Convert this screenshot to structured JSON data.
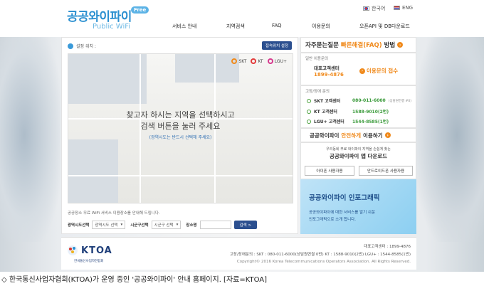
{
  "header": {
    "logo_title": "공공와이파이",
    "logo_badge": "Free",
    "logo_subtitle": "Public WiFi",
    "lang_ko": "한국어",
    "lang_en": "ENG",
    "nav": [
      "서비스 안내",
      "지역검색",
      "FAQ",
      "이용문의",
      "오픈API 및 DB다운로드"
    ]
  },
  "main": {
    "location_label": "설정 위치 :",
    "location_button": "접속위치 설정",
    "carriers": [
      {
        "name": "SKT",
        "color": "#f08a1c"
      },
      {
        "name": "KT",
        "color": "#e23b3b"
      },
      {
        "name": "LGU+",
        "color": "#d63a8e"
      }
    ],
    "map_message_line1": "찾고자 하시는 지역을 선택하시고",
    "map_message_line2": "검색 버튼을 눌러 주세요",
    "map_message_note": "(광역시도는 반드시 선택해 주세요)",
    "info_text": "공공장소 무료 WiFi 서비스 이용장소를 안내해 드립니다.",
    "search": {
      "sido_label": "광역시도선택",
      "sido_value": "광역시도 선택",
      "gugun_label": "시군구선택",
      "gugun_value": "시군구 선택",
      "place_label": "장소명",
      "place_value": "",
      "button": "검색 >"
    }
  },
  "side": {
    "faq_title_a": "자주묻는질문",
    "faq_title_b": "빠른해결(FAQ)",
    "faq_title_c": "방법",
    "general_label": "일반 이용문의",
    "center_name": "대표고객센터",
    "center_number": "1899-4876",
    "inquiry_link": "이용문의 접수",
    "fault_label": "고장/장애 문의",
    "telcos": [
      {
        "name": "SKT 고객센터",
        "number": "080-011-6000",
        "note": "(상담원연결 #0)"
      },
      {
        "name": "KT 고객센터",
        "number": "1588-9010(2번)",
        "note": ""
      },
      {
        "name": "LGU+ 고객센터",
        "number": "1544-8585(1번)",
        "note": ""
      }
    ],
    "safe_a": "공공와이파이",
    "safe_b": "안전하게",
    "safe_c": "이용하기",
    "app_desc": "우리동네 무료 와이파이 지역을 손쉽게 찾는",
    "app_title": "공공와이파이 앱 다운로드",
    "iphone_button": "아이폰 사용자용",
    "android_button": "안드로이드폰 사용자용",
    "info_title": "공공와이파이 인포그래픽",
    "info_desc1": "공공와이파이에 대한 서비스를 알기 쉬운",
    "info_desc2": "인포그래픽으로 소개 합니다."
  },
  "footer": {
    "ktoa_logo": "KTOA",
    "ktoa_sub": "한국통신사업자연합회",
    "center_line": "대표고객센터 : 1899-4876",
    "fault_line": "고장/장애문의 :   SKT : 080-011-6000(상담원연결 0번)    KT : 1588-9010(2번)    LGU+ : 1544-8585(1번)",
    "copyright": "Copyright© 2016 Korea Telecommunications Operators Association. All Rights Reserved."
  },
  "caption": "◇ 한국통신사업자협회(KTOA)가 운영 중인 '공공와이파이' 안내 홈페이지. [자료=KTOA]"
}
